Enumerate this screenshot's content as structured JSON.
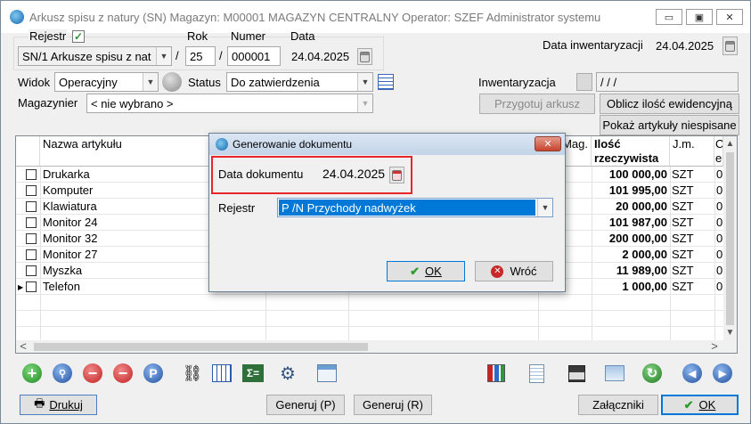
{
  "window": {
    "title": "Arkusz spisu z natury (SN)  Magazyn: M00001 MAGAZYN CENTRALNY  Operator: SZEF Administrator systemu",
    "min": "▭",
    "max": "▣",
    "close": "✕"
  },
  "header": {
    "rejestr_label": "Rejestr",
    "rok_label": "Rok",
    "numer_label": "Numer",
    "data_label": "Data",
    "rejestr_value": "SN/1 Arkusze spisu z nat",
    "rok_value": "25",
    "slash": "/",
    "numer_value": "000001",
    "data_value": "24.04.2025",
    "data_inw_label": "Data inwentaryzacji",
    "data_inw_value": "24.04.2025",
    "widok_label": "Widok",
    "widok_value": "Operacyjny",
    "status_label": "Status",
    "status_value": "Do zatwierdzenia",
    "inwent_label": "Inwentaryzacja",
    "inwent_value": "  /  /  /",
    "magazynier_label": "Magazynier",
    "magazynier_value": "< nie wybrano >",
    "btn_przygotuj": "Przygotuj arkusz",
    "btn_oblicz": "Oblicz ilość ewidencyjną",
    "btn_pokaz": "Pokaż artykuły niespisane"
  },
  "grid": {
    "col_name": "Nazwa artykułu",
    "col_mag": "Mag.",
    "col_ilosc1": "Ilość",
    "col_ilosc2": "rzeczywista",
    "col_jm": "J.m.",
    "col_last1": "C",
    "col_last2": "e",
    "rows": [
      {
        "name": "Drukarka",
        "qty": "100 000,00",
        "jm": "SZT",
        "c": "0"
      },
      {
        "name": "Komputer",
        "qty": "101 995,00",
        "jm": "SZT",
        "c": "0"
      },
      {
        "name": "Klawiatura",
        "qty": "20 000,00",
        "jm": "SZT",
        "c": "0"
      },
      {
        "name": "Monitor 24",
        "qty": "101 987,00",
        "jm": "SZT",
        "c": "0"
      },
      {
        "name": "Monitor 32",
        "qty": "200 000,00",
        "jm": "SZT",
        "c": "0"
      },
      {
        "name": "Monitor 27",
        "qty": "2 000,00",
        "jm": "SZT",
        "c": "0"
      },
      {
        "name": "Myszka",
        "qty": "11 989,00",
        "jm": "SZT",
        "c": "0"
      },
      {
        "name": "Telefon",
        "qty": "1 000,00",
        "jm": "SZT",
        "c": "0"
      }
    ],
    "scroll_left": "<",
    "scroll_right": ">",
    "scroll_up": "^",
    "scroll_down": "v"
  },
  "toolbar": {
    "icons": [
      "add-icon",
      "view-icon",
      "delete-icon",
      "delete-check-icon",
      "p-icon",
      "binoculars-icon",
      "grid-filter-icon",
      "sum-icon",
      "hierarchy-icon",
      "window-icon",
      "chart-icon",
      "document-icon",
      "save-icon",
      "copy-icon",
      "refresh-icon",
      "prev-icon",
      "next-icon"
    ],
    "p_text": "P"
  },
  "footer": {
    "drukuj": "Drukuj",
    "generuj_p": "Generuj (P)",
    "generuj_r": "Generuj (R)",
    "zalaczniki": "Załączniki",
    "ok": "OK"
  },
  "dialog": {
    "title": "Generowanie dokumentu",
    "close": "✕",
    "data_label": "Data dokumentu",
    "data_value": "24.04.2025",
    "rejestr_label": "Rejestr",
    "rejestr_value": "P /N Przychody nadwyżek",
    "ok": "OK",
    "wroc": "Wróć"
  },
  "colors": {
    "highlight_red": "#e8272a",
    "selection_blue": "#0078d7",
    "ok_green": "#2e9b2e"
  }
}
